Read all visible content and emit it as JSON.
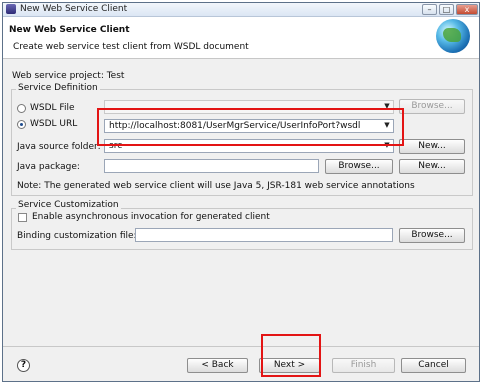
{
  "window": {
    "title": "New Web Service Client"
  },
  "header": {
    "title": "New Web Service Client",
    "description": "Create web service test client from WSDL document"
  },
  "project": {
    "label": "Web service project: Test"
  },
  "definition": {
    "group_label": "Service Definition",
    "wsdl_file_label": "WSDL File",
    "wsdl_url_label": "WSDL URL",
    "wsdl_url_value": "http://localhost:8081/UserMgrService/UserInfoPort?wsdl",
    "browse_label": "Browse...",
    "source_folder_label": "Java source folder:",
    "source_folder_value": "src",
    "new_label": "New...",
    "package_label": "Java package:",
    "package_browse_label": "Browse...",
    "package_new_label": "New...",
    "note": "Note: The generated web service client will use Java 5, JSR-181 web service annotations"
  },
  "customization": {
    "group_label": "Service Customization",
    "async_label": "Enable asynchronous invocation for generated client",
    "binding_label": "Binding customization file:",
    "binding_browse_label": "Browse..."
  },
  "footer": {
    "help_glyph": "?",
    "back_label": "< Back",
    "next_label": "Next >",
    "finish_label": "Finish",
    "cancel_label": "Cancel"
  },
  "icons": {
    "window": "app-icon",
    "header": "globe-icon",
    "help": "help-icon"
  },
  "colors": {
    "highlight": "#e31414",
    "accent": "#1f4d8f"
  }
}
